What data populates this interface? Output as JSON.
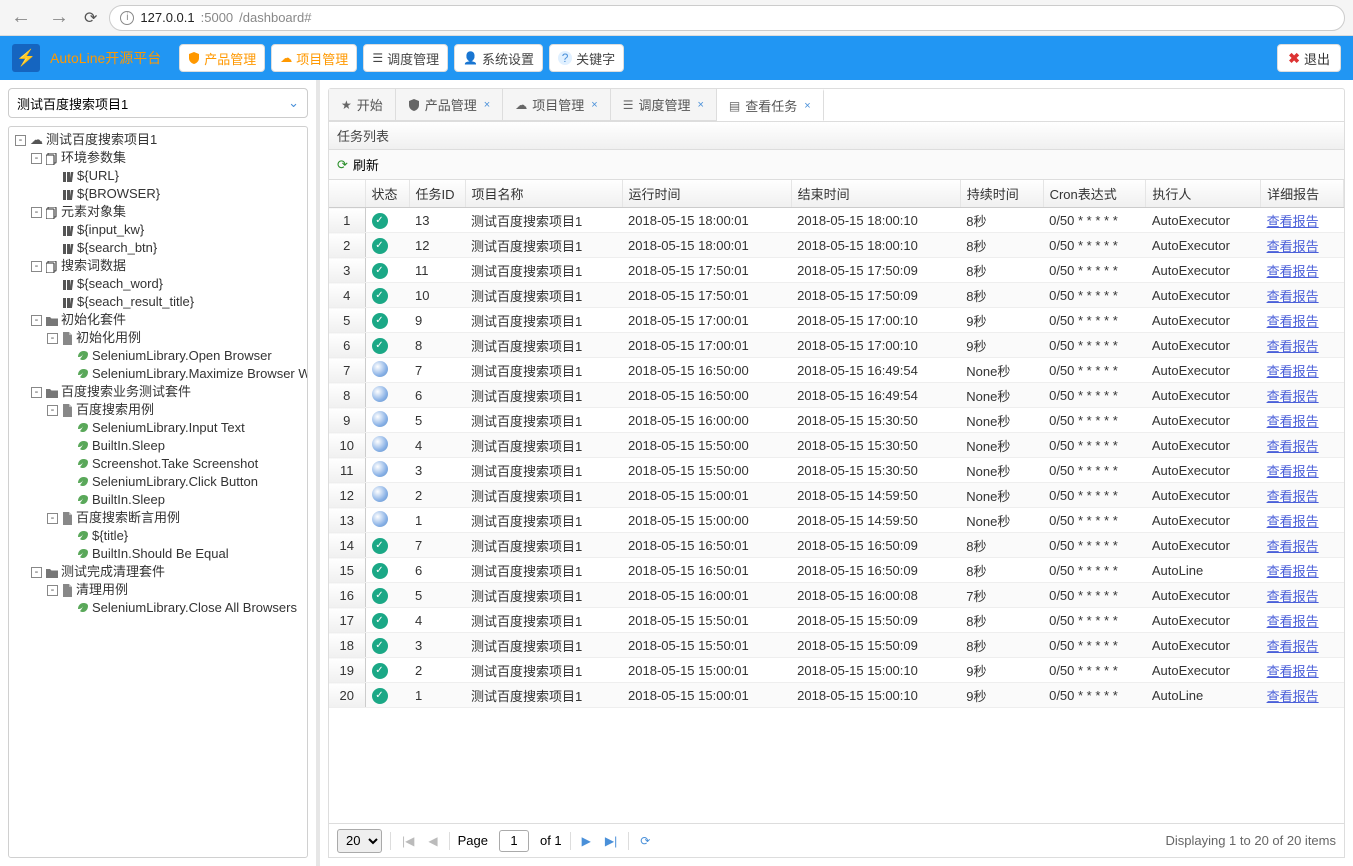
{
  "browser": {
    "url_host": "127.0.0.1",
    "url_port": ":5000",
    "url_path": "/dashboard#"
  },
  "header": {
    "app_title": "AutoLine开源平台",
    "buttons": {
      "product": "产品管理",
      "project": "项目管理",
      "schedule": "调度管理",
      "system": "系统设置",
      "keyword": "关键字"
    },
    "exit": "退出"
  },
  "sidebar": {
    "project_selected": "测试百度搜索项目1",
    "tree": [
      {
        "d": 0,
        "t": "-",
        "i": "cloud",
        "l": "测试百度搜索项目1"
      },
      {
        "d": 1,
        "t": "-",
        "i": "copy",
        "l": "环境参数集"
      },
      {
        "d": 2,
        "t": "",
        "i": "lib",
        "l": "${URL}"
      },
      {
        "d": 2,
        "t": "",
        "i": "lib",
        "l": "${BROWSER}"
      },
      {
        "d": 1,
        "t": "-",
        "i": "copy",
        "l": "元素对象集"
      },
      {
        "d": 2,
        "t": "",
        "i": "lib",
        "l": "${input_kw}"
      },
      {
        "d": 2,
        "t": "",
        "i": "lib",
        "l": "${search_btn}"
      },
      {
        "d": 1,
        "t": "-",
        "i": "copy",
        "l": "搜索词数据"
      },
      {
        "d": 2,
        "t": "",
        "i": "lib",
        "l": "${seach_word}"
      },
      {
        "d": 2,
        "t": "",
        "i": "lib",
        "l": "${seach_result_title}"
      },
      {
        "d": 1,
        "t": "-",
        "i": "folder",
        "l": "初始化套件"
      },
      {
        "d": 2,
        "t": "-",
        "i": "file",
        "l": "初始化用例"
      },
      {
        "d": 3,
        "t": "",
        "i": "leaf",
        "l": "SeleniumLibrary.Open Browser"
      },
      {
        "d": 3,
        "t": "",
        "i": "leaf",
        "l": "SeleniumLibrary.Maximize Browser Wii"
      },
      {
        "d": 1,
        "t": "-",
        "i": "folder",
        "l": "百度搜索业务测试套件"
      },
      {
        "d": 2,
        "t": "-",
        "i": "file",
        "l": "百度搜索用例"
      },
      {
        "d": 3,
        "t": "",
        "i": "leaf",
        "l": "SeleniumLibrary.Input Text"
      },
      {
        "d": 3,
        "t": "",
        "i": "leaf",
        "l": "BuiltIn.Sleep"
      },
      {
        "d": 3,
        "t": "",
        "i": "leaf",
        "l": "Screenshot.Take Screenshot"
      },
      {
        "d": 3,
        "t": "",
        "i": "leaf",
        "l": "SeleniumLibrary.Click Button"
      },
      {
        "d": 3,
        "t": "",
        "i": "leaf",
        "l": "BuiltIn.Sleep"
      },
      {
        "d": 2,
        "t": "-",
        "i": "file",
        "l": "百度搜索断言用例"
      },
      {
        "d": 3,
        "t": "",
        "i": "leaf",
        "l": "${title}"
      },
      {
        "d": 3,
        "t": "",
        "i": "leaf",
        "l": "BuiltIn.Should Be Equal"
      },
      {
        "d": 1,
        "t": "-",
        "i": "folder",
        "l": "测试完成清理套件"
      },
      {
        "d": 2,
        "t": "-",
        "i": "file",
        "l": "清理用例"
      },
      {
        "d": 3,
        "t": "",
        "i": "leaf",
        "l": "SeleniumLibrary.Close All Browsers"
      }
    ]
  },
  "tabs": [
    {
      "icon": "star",
      "label": "开始",
      "closable": false
    },
    {
      "icon": "shield",
      "label": "产品管理",
      "closable": true
    },
    {
      "icon": "cloud",
      "label": "项目管理",
      "closable": true
    },
    {
      "icon": "list",
      "label": "调度管理",
      "closable": true
    },
    {
      "icon": "list2",
      "label": "查看任务",
      "closable": true,
      "active": true
    }
  ],
  "panel": {
    "title": "任务列表",
    "refresh": "刷新"
  },
  "grid": {
    "cols": [
      "",
      "状态",
      "任务ID",
      "项目名称",
      "运行时间",
      "结束时间",
      "持续时间",
      "Cron表达式",
      "执行人",
      "详细报告"
    ],
    "link_label": "查看报告",
    "rows": [
      {
        "n": 1,
        "st": "ok",
        "id": "13",
        "name": "测试百度搜索项目1",
        "start": "2018-05-15 18:00:01",
        "end": "2018-05-15 18:00:10",
        "dur": "8秒",
        "cron": "0/50 * * * * *",
        "exec": "AutoExecutor"
      },
      {
        "n": 2,
        "st": "ok",
        "id": "12",
        "name": "测试百度搜索项目1",
        "start": "2018-05-15 18:00:01",
        "end": "2018-05-15 18:00:10",
        "dur": "8秒",
        "cron": "0/50 * * * * *",
        "exec": "AutoExecutor"
      },
      {
        "n": 3,
        "st": "ok",
        "id": "11",
        "name": "测试百度搜索项目1",
        "start": "2018-05-15 17:50:01",
        "end": "2018-05-15 17:50:09",
        "dur": "8秒",
        "cron": "0/50 * * * * *",
        "exec": "AutoExecutor"
      },
      {
        "n": 4,
        "st": "ok",
        "id": "10",
        "name": "测试百度搜索项目1",
        "start": "2018-05-15 17:50:01",
        "end": "2018-05-15 17:50:09",
        "dur": "8秒",
        "cron": "0/50 * * * * *",
        "exec": "AutoExecutor"
      },
      {
        "n": 5,
        "st": "ok",
        "id": "9",
        "name": "测试百度搜索项目1",
        "start": "2018-05-15 17:00:01",
        "end": "2018-05-15 17:00:10",
        "dur": "9秒",
        "cron": "0/50 * * * * *",
        "exec": "AutoExecutor"
      },
      {
        "n": 6,
        "st": "ok",
        "id": "8",
        "name": "测试百度搜索项目1",
        "start": "2018-05-15 17:00:01",
        "end": "2018-05-15 17:00:10",
        "dur": "9秒",
        "cron": "0/50 * * * * *",
        "exec": "AutoExecutor"
      },
      {
        "n": 7,
        "st": "run",
        "id": "7",
        "name": "测试百度搜索项目1",
        "start": "2018-05-15 16:50:00",
        "end": "2018-05-15 16:49:54",
        "dur": "None秒",
        "cron": "0/50 * * * * *",
        "exec": "AutoExecutor"
      },
      {
        "n": 8,
        "st": "run",
        "id": "6",
        "name": "测试百度搜索项目1",
        "start": "2018-05-15 16:50:00",
        "end": "2018-05-15 16:49:54",
        "dur": "None秒",
        "cron": "0/50 * * * * *",
        "exec": "AutoExecutor"
      },
      {
        "n": 9,
        "st": "run",
        "id": "5",
        "name": "测试百度搜索项目1",
        "start": "2018-05-15 16:00:00",
        "end": "2018-05-15 15:30:50",
        "dur": "None秒",
        "cron": "0/50 * * * * *",
        "exec": "AutoExecutor"
      },
      {
        "n": 10,
        "st": "run",
        "id": "4",
        "name": "测试百度搜索项目1",
        "start": "2018-05-15 15:50:00",
        "end": "2018-05-15 15:30:50",
        "dur": "None秒",
        "cron": "0/50 * * * * *",
        "exec": "AutoExecutor"
      },
      {
        "n": 11,
        "st": "run",
        "id": "3",
        "name": "测试百度搜索项目1",
        "start": "2018-05-15 15:50:00",
        "end": "2018-05-15 15:30:50",
        "dur": "None秒",
        "cron": "0/50 * * * * *",
        "exec": "AutoExecutor"
      },
      {
        "n": 12,
        "st": "run",
        "id": "2",
        "name": "测试百度搜索项目1",
        "start": "2018-05-15 15:00:01",
        "end": "2018-05-15 14:59:50",
        "dur": "None秒",
        "cron": "0/50 * * * * *",
        "exec": "AutoExecutor"
      },
      {
        "n": 13,
        "st": "run",
        "id": "1",
        "name": "测试百度搜索项目1",
        "start": "2018-05-15 15:00:00",
        "end": "2018-05-15 14:59:50",
        "dur": "None秒",
        "cron": "0/50 * * * * *",
        "exec": "AutoExecutor"
      },
      {
        "n": 14,
        "st": "ok",
        "id": "7",
        "name": "测试百度搜索项目1",
        "start": "2018-05-15 16:50:01",
        "end": "2018-05-15 16:50:09",
        "dur": "8秒",
        "cron": "0/50 * * * * *",
        "exec": "AutoExecutor"
      },
      {
        "n": 15,
        "st": "ok",
        "id": "6",
        "name": "测试百度搜索项目1",
        "start": "2018-05-15 16:50:01",
        "end": "2018-05-15 16:50:09",
        "dur": "8秒",
        "cron": "0/50 * * * * *",
        "exec": "AutoLine"
      },
      {
        "n": 16,
        "st": "ok",
        "id": "5",
        "name": "测试百度搜索项目1",
        "start": "2018-05-15 16:00:01",
        "end": "2018-05-15 16:00:08",
        "dur": "7秒",
        "cron": "0/50 * * * * *",
        "exec": "AutoExecutor"
      },
      {
        "n": 17,
        "st": "ok",
        "id": "4",
        "name": "测试百度搜索项目1",
        "start": "2018-05-15 15:50:01",
        "end": "2018-05-15 15:50:09",
        "dur": "8秒",
        "cron": "0/50 * * * * *",
        "exec": "AutoExecutor"
      },
      {
        "n": 18,
        "st": "ok",
        "id": "3",
        "name": "测试百度搜索项目1",
        "start": "2018-05-15 15:50:01",
        "end": "2018-05-15 15:50:09",
        "dur": "8秒",
        "cron": "0/50 * * * * *",
        "exec": "AutoExecutor"
      },
      {
        "n": 19,
        "st": "ok",
        "id": "2",
        "name": "测试百度搜索项目1",
        "start": "2018-05-15 15:00:01",
        "end": "2018-05-15 15:00:10",
        "dur": "9秒",
        "cron": "0/50 * * * * *",
        "exec": "AutoExecutor"
      },
      {
        "n": 20,
        "st": "ok",
        "id": "1",
        "name": "测试百度搜索项目1",
        "start": "2018-05-15 15:00:01",
        "end": "2018-05-15 15:00:10",
        "dur": "9秒",
        "cron": "0/50 * * * * *",
        "exec": "AutoLine"
      }
    ]
  },
  "pager": {
    "pagesize": "20",
    "page_label": "Page",
    "page": "1",
    "of_label": "of 1",
    "info": "Displaying 1 to 20 of 20 items"
  }
}
